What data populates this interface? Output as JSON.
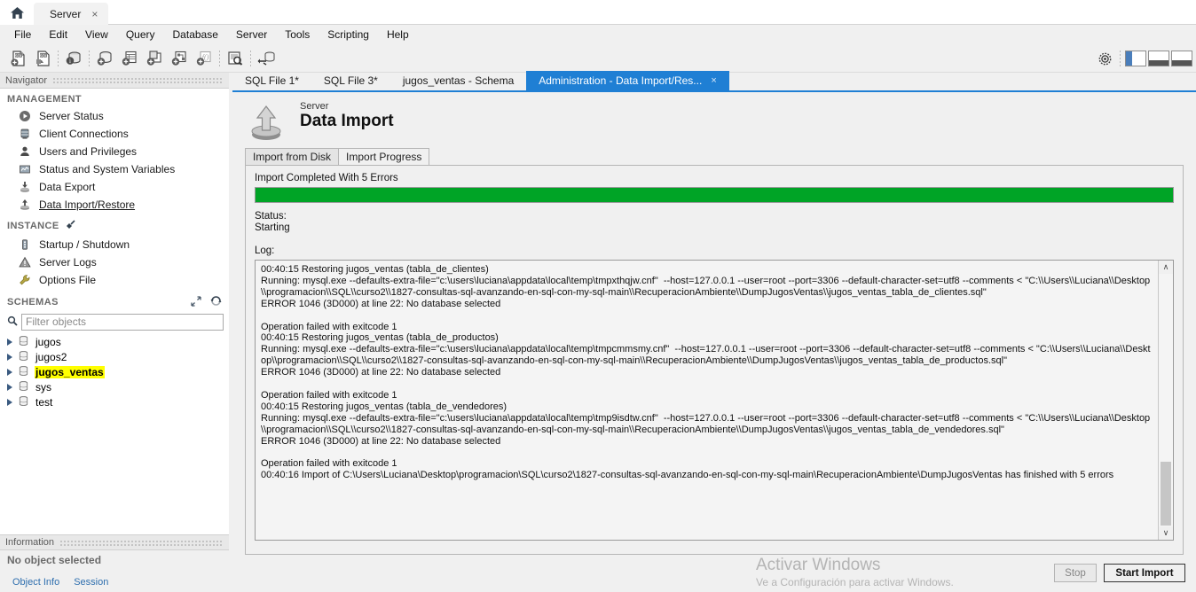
{
  "titlebar": {
    "home_icon": "home-icon",
    "server_tab": "Server",
    "close_glyph": "×"
  },
  "menu": {
    "items": [
      "File",
      "Edit",
      "View",
      "Query",
      "Database",
      "Server",
      "Tools",
      "Scripting",
      "Help"
    ]
  },
  "toolbar": {
    "icons": [
      "new-sql-file-icon",
      "open-sql-file-icon",
      "connection-info-icon",
      "new-schema-icon",
      "new-table-icon",
      "new-view-icon",
      "new-routine-icon",
      "new-function-icon",
      "inspector-icon",
      "reconnect-icon"
    ],
    "right_icons": [
      "settings-icon",
      "toggle-sidebar-icon",
      "toggle-output-icon",
      "toggle-secondary-icon"
    ]
  },
  "sidebar": {
    "header": "Navigator",
    "management": {
      "title": "MANAGEMENT",
      "items": [
        {
          "label": "Server Status",
          "icon": "server-status-icon"
        },
        {
          "label": "Client Connections",
          "icon": "client-connections-icon"
        },
        {
          "label": "Users and Privileges",
          "icon": "users-privileges-icon"
        },
        {
          "label": "Status and System Variables",
          "icon": "status-variables-icon"
        },
        {
          "label": "Data Export",
          "icon": "data-export-icon"
        },
        {
          "label": "Data Import/Restore",
          "icon": "data-import-icon",
          "active": true
        }
      ]
    },
    "instance": {
      "title": "INSTANCE",
      "items": [
        {
          "label": "Startup / Shutdown",
          "icon": "startup-shutdown-icon"
        },
        {
          "label": "Server Logs",
          "icon": "server-logs-icon"
        },
        {
          "label": "Options File",
          "icon": "options-file-icon"
        }
      ]
    },
    "schemas": {
      "title": "SCHEMAS",
      "expand_icon": "expand-all-icon",
      "refresh_icon": "refresh-icon",
      "filter_placeholder": "Filter objects",
      "filter_value": "",
      "search_icon": "search-icon",
      "items": [
        {
          "name": "jugos",
          "highlighted": false
        },
        {
          "name": "jugos2",
          "highlighted": false
        },
        {
          "name": "jugos_ventas",
          "highlighted": true
        },
        {
          "name": "sys",
          "highlighted": false
        },
        {
          "name": "test",
          "highlighted": false
        }
      ]
    },
    "information": {
      "header": "Information",
      "body": "No object selected",
      "tabs": [
        "Object Info",
        "Session"
      ]
    }
  },
  "doc_tabs": [
    {
      "label": "SQL File 1*",
      "selected": false
    },
    {
      "label": "SQL File 3*",
      "selected": false
    },
    {
      "label": "jugos_ventas - Schema",
      "selected": false
    },
    {
      "label": "Administration - Data Import/Res...",
      "selected": true,
      "close_glyph": "×"
    }
  ],
  "page": {
    "icon": "data-import-large-icon",
    "supertitle": "Server",
    "title": "Data Import",
    "subtabs": [
      {
        "label": "Import from Disk",
        "selected": false
      },
      {
        "label": "Import Progress",
        "selected": true
      }
    ]
  },
  "progress": {
    "title": "Import Completed With 5 Errors",
    "bar_percent": 100,
    "bar_color": "#00a426",
    "status_label": "Status:",
    "status_value": "Starting",
    "log_label": "Log:",
    "log_text": "00:40:15 Restoring jugos_ventas (tabla_de_clientes)\nRunning: mysql.exe --defaults-extra-file=\"c:\\users\\luciana\\appdata\\local\\temp\\tmpxthqjw.cnf\"  --host=127.0.0.1 --user=root --port=3306 --default-character-set=utf8 --comments < \"C:\\\\Users\\\\Luciana\\\\Desktop\\\\programacion\\\\SQL\\\\curso2\\\\1827-consultas-sql-avanzando-en-sql-con-my-sql-main\\\\RecuperacionAmbiente\\\\DumpJugosVentas\\\\jugos_ventas_tabla_de_clientes.sql\"\nERROR 1046 (3D000) at line 22: No database selected\n\nOperation failed with exitcode 1\n00:40:15 Restoring jugos_ventas (tabla_de_productos)\nRunning: mysql.exe --defaults-extra-file=\"c:\\users\\luciana\\appdata\\local\\temp\\tmpcmmsmy.cnf\"  --host=127.0.0.1 --user=root --port=3306 --default-character-set=utf8 --comments < \"C:\\\\Users\\\\Luciana\\\\Desktop\\\\programacion\\\\SQL\\\\curso2\\\\1827-consultas-sql-avanzando-en-sql-con-my-sql-main\\\\RecuperacionAmbiente\\\\DumpJugosVentas\\\\jugos_ventas_tabla_de_productos.sql\"\nERROR 1046 (3D000) at line 22: No database selected\n\nOperation failed with exitcode 1\n00:40:15 Restoring jugos_ventas (tabla_de_vendedores)\nRunning: mysql.exe --defaults-extra-file=\"c:\\users\\luciana\\appdata\\local\\temp\\tmp9isdtw.cnf\"  --host=127.0.0.1 --user=root --port=3306 --default-character-set=utf8 --comments < \"C:\\\\Users\\\\Luciana\\\\Desktop\\\\programacion\\\\SQL\\\\curso2\\\\1827-consultas-sql-avanzando-en-sql-con-my-sql-main\\\\RecuperacionAmbiente\\\\DumpJugosVentas\\\\jugos_ventas_tabla_de_vendedores.sql\"\nERROR 1046 (3D000) at line 22: No database selected\n\nOperation failed with exitcode 1\n00:40:16 Import of C:\\Users\\Luciana\\Desktop\\programacion\\SQL\\curso2\\1827-consultas-sql-avanzando-en-sql-con-my-sql-main\\RecuperacionAmbiente\\DumpJugosVentas has finished with 5 errors\n",
    "scroll_up_glyph": "∧",
    "scroll_down_glyph": "∨"
  },
  "footer": {
    "watermark_line1": "Activar Windows",
    "watermark_line2": "Ve a Configuración para activar Windows.",
    "stop_label": "Stop",
    "start_label": "Start Import"
  }
}
